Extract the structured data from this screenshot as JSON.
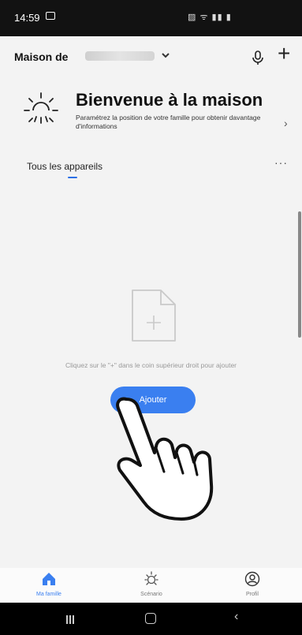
{
  "status_bar": {
    "time": "14:59",
    "right_icons": "▨ ᯤ ▮▮ ▮"
  },
  "header": {
    "home_label": "Maison de",
    "dropdown_icon": "chevron-down-icon",
    "mic_icon": "microphone-icon",
    "add_icon": "+"
  },
  "welcome": {
    "title": "Bienvenue à la maison",
    "subtitle": "Paramétrez la position de votre famille pour obtenir davantage d'informations",
    "arrow": "›"
  },
  "devices": {
    "tab_label": "Tous les appareils",
    "more_label": "···"
  },
  "empty_state": {
    "message": "Cliquez sur le \"+\" dans le coin supérieur droit pour ajouter",
    "button_label": "Ajouter"
  },
  "tab_bar": {
    "items": [
      {
        "label": "Ma famille",
        "icon": "home-icon",
        "active": true
      },
      {
        "label": "Scénario",
        "icon": "scene-sun-icon",
        "active": false
      },
      {
        "label": "Profil",
        "icon": "profile-icon",
        "active": false
      }
    ]
  },
  "colors": {
    "accent": "#3a7ff0",
    "background": "#f3f3f3",
    "status_bar": "#121212"
  }
}
